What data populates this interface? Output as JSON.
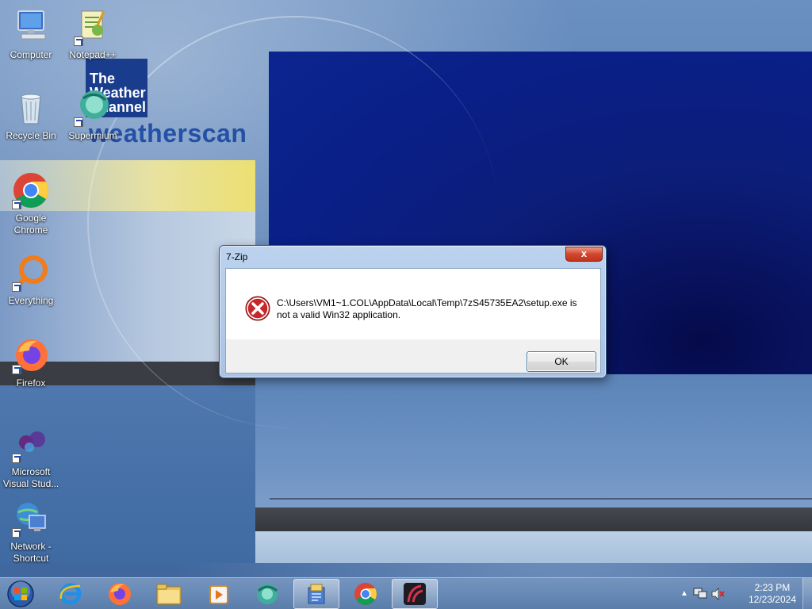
{
  "wallpaper": {
    "logo_line1": "The",
    "logo_line2": "Weather",
    "logo_line3": "Channel",
    "brand": "weatherscan"
  },
  "desktop_icons": [
    {
      "label": "Computer",
      "icon": "computer-icon"
    },
    {
      "label": "Notepad++",
      "icon": "notepad-plus-plus-icon"
    },
    {
      "label": "Recycle Bin",
      "icon": "recycle-bin-icon"
    },
    {
      "label": "Supermium",
      "icon": "supermium-icon"
    },
    {
      "label": "Google Chrome",
      "icon": "chrome-icon"
    },
    {
      "label": "Everything",
      "icon": "everything-icon"
    },
    {
      "label": "Firefox",
      "icon": "firefox-icon"
    },
    {
      "label": "Microsoft Visual Stud...",
      "icon": "visual-studio-icon"
    },
    {
      "label": "Network - Shortcut",
      "icon": "network-icon"
    }
  ],
  "dialog": {
    "title": "7-Zip",
    "close_label": "x",
    "message": "C:\\Users\\VM1~1.COL\\AppData\\Local\\Temp\\7zS45735EA2\\setup.exe is not a valid Win32 application.",
    "ok_label": "OK",
    "icon": "error-icon"
  },
  "taskbar": {
    "items": [
      {
        "name": "internet-explorer",
        "icon": "ie-icon"
      },
      {
        "name": "firefox",
        "icon": "firefox-icon"
      },
      {
        "name": "file-explorer",
        "icon": "folder-icon"
      },
      {
        "name": "media-player",
        "icon": "media-player-icon"
      },
      {
        "name": "supermium",
        "icon": "supermium-icon"
      },
      {
        "name": "7zip-setup",
        "icon": "installer-icon"
      },
      {
        "name": "chrome",
        "icon": "chrome-icon"
      },
      {
        "name": "app",
        "icon": "red-arc-icon"
      }
    ],
    "clock_time": "2:23 PM",
    "clock_date": "12/23/2024"
  },
  "colors": {
    "close_red": "#c2331a",
    "dialog_frame": "#a9c3e4",
    "wallpaper_navy": "#0a1f87"
  }
}
